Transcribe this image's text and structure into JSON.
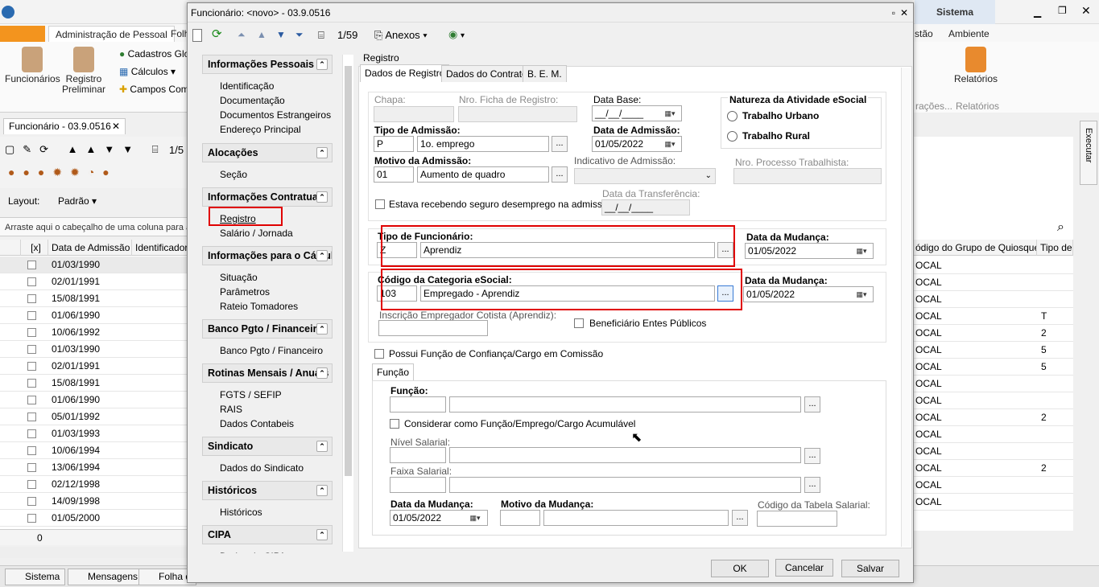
{
  "app": {
    "ribbon_tabs": [
      "Administração de Pessoal",
      "Folh",
      "stão",
      "Ambiente"
    ],
    "title_right": "Sistema",
    "ribbon": {
      "funcionarios": "Funcionários",
      "registro_preliminar_1": "Registro",
      "registro_preliminar_2": "Preliminar",
      "cadastros": "Cadastros Glo",
      "calculos": "Cálculos",
      "campos": "Campos Comp",
      "relatorios": "Relatórios",
      "relatorios_group": "Relatórios",
      "acoes_group": "rações..."
    },
    "doc_tab": "Funcionário - 03.9.0516",
    "toolbar_counter": "1/5",
    "layout_label": "Layout:",
    "layout_value": "Padrão",
    "group_hint": "Arraste aqui o cabeçalho de uma coluna para a",
    "grid": {
      "headers": [
        "[x]",
        "Data de Admissão",
        "Identificador"
      ],
      "rows": [
        "01/03/1990",
        "02/01/1991",
        "15/08/1991",
        "01/06/1990",
        "10/06/1992",
        "01/03/1990",
        "02/01/1991",
        "15/08/1991",
        "01/06/1990",
        "05/01/1992",
        "01/03/1993",
        "10/06/1994",
        "13/06/1994",
        "02/12/1998",
        "14/09/1998",
        "01/05/2000"
      ],
      "footer_count": "0"
    },
    "right_grid": {
      "headers": [
        "ódigo do Grupo de Quiosque",
        "Tipo de D"
      ],
      "rows": [
        [
          "OCAL",
          ""
        ],
        [
          "OCAL",
          ""
        ],
        [
          "OCAL",
          ""
        ],
        [
          "OCAL",
          "T"
        ],
        [
          "OCAL",
          "2"
        ],
        [
          "OCAL",
          "5"
        ],
        [
          "OCAL",
          "5"
        ],
        [
          "OCAL",
          ""
        ],
        [
          "OCAL",
          ""
        ],
        [
          "OCAL",
          "2"
        ],
        [
          "OCAL",
          ""
        ],
        [
          "OCAL",
          ""
        ],
        [
          "OCAL",
          "2"
        ],
        [
          "OCAL",
          ""
        ],
        [
          "OCAL",
          ""
        ]
      ],
      "executar": "Executar"
    },
    "taskbar": [
      "Sistema",
      "Mensagens",
      "Folha d"
    ]
  },
  "dialog": {
    "title": "Funcionário: <novo> - 03.9.0516",
    "counter": "1/59",
    "anexos": "Anexos",
    "nav": [
      {
        "header": "Informações Pessoais",
        "items": [
          "Identificação",
          "Documentação",
          "Documentos Estrangeiros",
          "Endereço Principal"
        ]
      },
      {
        "header": "Alocações",
        "items": [
          "Seção"
        ]
      },
      {
        "header": "Informações Contratuais",
        "items": [
          "Registro",
          "Salário / Jornada"
        ]
      },
      {
        "header": "Informações para o Cálculo",
        "items": [
          "Situação",
          "Parâmetros",
          "Rateio Tomadores"
        ]
      },
      {
        "header": "Banco Pgto / Financeiro",
        "items": [
          "Banco Pgto / Financeiro"
        ]
      },
      {
        "header": "Rotinas Mensais / Anuais",
        "items": [
          "FGTS / SEFIP",
          "RAIS",
          "Dados Contabeis"
        ]
      },
      {
        "header": "Sindicato",
        "items": [
          "Dados do Sindicato"
        ]
      },
      {
        "header": "Históricos",
        "items": [
          "Históricos"
        ]
      },
      {
        "header": "CIPA",
        "items": [
          "Dados da CIPA"
        ]
      }
    ],
    "section_title": "Registro",
    "tabs": [
      "Dados de Registro",
      "Dados do Contrato",
      "B. E. M."
    ],
    "form": {
      "chapa_label": "Chapa:",
      "ficha_label": "Nro. Ficha de Registro:",
      "data_base_label": "Data Base:",
      "data_base_value": "__/__/____",
      "natureza_label": "Natureza da Atividade eSocial",
      "trabalho_urbano": "Trabalho Urbano",
      "trabalho_rural": "Trabalho Rural",
      "tipo_admissao_label": "Tipo de Admissão:",
      "tipo_admissao_code": "P",
      "tipo_admissao_desc": "1o. emprego",
      "data_admissao_label": "Data de Admissão:",
      "data_admissao_value": "01/05/2022",
      "motivo_label": "Motivo da Admissão:",
      "motivo_code": "01",
      "motivo_desc": "Aumento de quadro",
      "indicativo_label": "Indicativo de Admissão:",
      "processo_label": "Nro. Processo Trabalhista:",
      "seguro_label": "Estava recebendo seguro desemprego na admissão",
      "data_transf_label": "Data da Transferência:",
      "data_transf_value": "__/__/____",
      "tipo_func_label": "Tipo de Funcionário:",
      "tipo_func_code": "Z",
      "tipo_func_desc": "Aprendiz",
      "data_mud1_label": "Data da Mudança:",
      "data_mud1_value": "01/05/2022",
      "categoria_label": "Código da Categoria eSocial:",
      "categoria_code": "103",
      "categoria_desc": "Empregado - Aprendiz",
      "data_mud2_label": "Data da Mudança:",
      "data_mud2_value": "01/05/2022",
      "inscricao_label": "Inscrição Empregador Cotista (Aprendiz):",
      "beneficiario_label": "Beneficiário Entes Públicos",
      "confianca_label": "Possui Função de Confiança/Cargo em Comissão",
      "funcao_tab": "Função",
      "funcao_label": "Função:",
      "acumulavel_label": "Considerar como Função/Emprego/Cargo Acumulável",
      "nivel_label": "Nível Salarial:",
      "faixa_label": "Faixa Salarial:",
      "data_mud3_label": "Data da Mudança:",
      "data_mud3_value": "01/05/2022",
      "motivo_mud_label": "Motivo da Mudança:",
      "tabela_label": "Código da Tabela Salarial:"
    },
    "buttons": {
      "ok": "OK",
      "cancelar": "Cancelar",
      "salvar": "Salvar"
    }
  }
}
